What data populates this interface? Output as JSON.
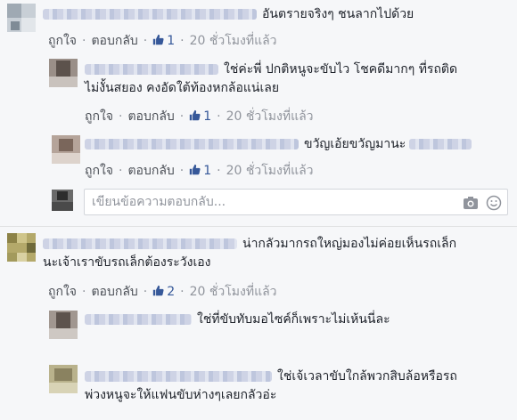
{
  "colors": {
    "background": "#f6f7f9",
    "link": "#365899",
    "meta": "#90949c",
    "text": "#1d2129"
  },
  "labels": {
    "like": "ถูกใจ",
    "reply": "ตอบกลับ",
    "separator": "·"
  },
  "reply_placeholder": "เขียนข้อความตอบกลับ...",
  "comments": [
    {
      "line1": "อันตรายจริงๆ ชนลากไปด้วย",
      "likes": "1",
      "time": "20 ชั่วโมงที่แล้ว"
    },
    {
      "line1": "ใช่ค่ะพี่ ปกติหนูจะขับไว โชคดีมากๆ ที่รถติด",
      "line2": "ไม่งั้นสยอง คงอัดใต้ท้องหกล้อแน่เลย",
      "likes": "1",
      "time": "20 ชั่วโมงที่แล้ว"
    },
    {
      "line1": "ขวัญเอ้ยขวัญมานะ",
      "likes": "1",
      "time": "20 ชั่วโมงที่แล้ว"
    },
    {
      "line1": "น่ากลัวมากรถใหญ่มองไม่ค่อยเห็นรถเล็ก",
      "line2": "นะเจ้าเราขับรถเล็กต้องระวังเอง",
      "likes": "2",
      "time": "20 ชั่วโมงที่แล้ว"
    },
    {
      "line1": "ใช่ที่ขับทับมอไซค์ก็เพราะไม่เห้นนี่ละ"
    },
    {
      "line1": "ใช่เจ้เวลาขับใกล้พวกสิบล้อหรือรถ",
      "line2": "พ่วงหนูจะให้แฟนขับห่างๆเลยกลัวอ่ะ"
    }
  ]
}
